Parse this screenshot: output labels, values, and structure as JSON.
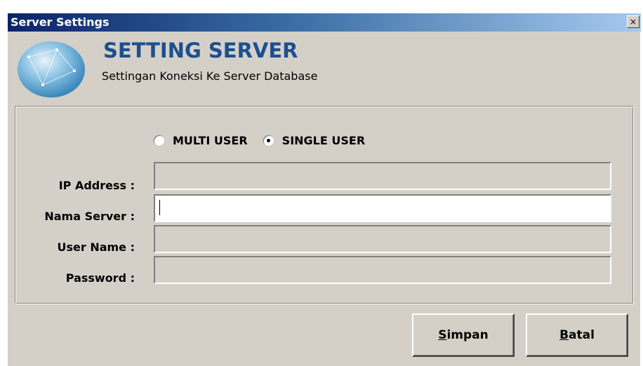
{
  "window": {
    "title": "Server Settings",
    "close_glyph": "×"
  },
  "header": {
    "title": "SETTING SERVER",
    "subtitle": "Settingan Koneksi Ke Server Database",
    "logo_icon": "globe-network-icon"
  },
  "mode": {
    "options": [
      {
        "label": "MULTI USER",
        "checked": false
      },
      {
        "label": "SINGLE USER",
        "checked": true
      }
    ]
  },
  "fields": [
    {
      "label": "IP Address :",
      "value": "",
      "enabled": false
    },
    {
      "label": "Nama Server :",
      "value": "",
      "enabled": true
    },
    {
      "label": "User Name :",
      "value": "",
      "enabled": false
    },
    {
      "label": "Password :",
      "value": "",
      "enabled": false
    }
  ],
  "buttons": {
    "save": {
      "mnemonic": "S",
      "rest": "impan"
    },
    "cancel": {
      "mnemonic": "B",
      "rest": "atal"
    }
  },
  "colors": {
    "title_gradient_start": "#0a246a",
    "header_title": "#1d4f8f",
    "face": "#d4d0c8"
  }
}
